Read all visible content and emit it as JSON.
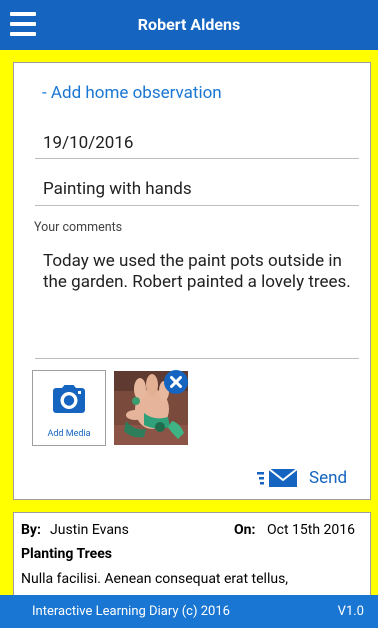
{
  "header": {
    "title": "Robert Aldens",
    "menu_icon": "hamburger-menu-icon"
  },
  "form": {
    "add_link": "- Add home observation",
    "date_value": "19/10/2016",
    "activity_value": "Painting with hands",
    "comments_label": "Your comments",
    "comments_value": "Today we used the paint pots outside in the garden. Robert painted a lovely trees.",
    "add_media_label": "Add Media",
    "send_label": "Send"
  },
  "entry": {
    "by_label": "By:",
    "by_value": "Justin Evans",
    "on_label": "On:",
    "on_value": "Oct 15th 2016",
    "title": "Planting Trees",
    "body": "Nulla facilisi. Aenean consequat erat tellus,"
  },
  "footer": {
    "text": "Interactive Learning Diary (c) 2016",
    "version": "V1.0"
  },
  "colors": {
    "header": "#1565c0",
    "accent": "#1976d2",
    "page_bg": "#ffff00"
  }
}
